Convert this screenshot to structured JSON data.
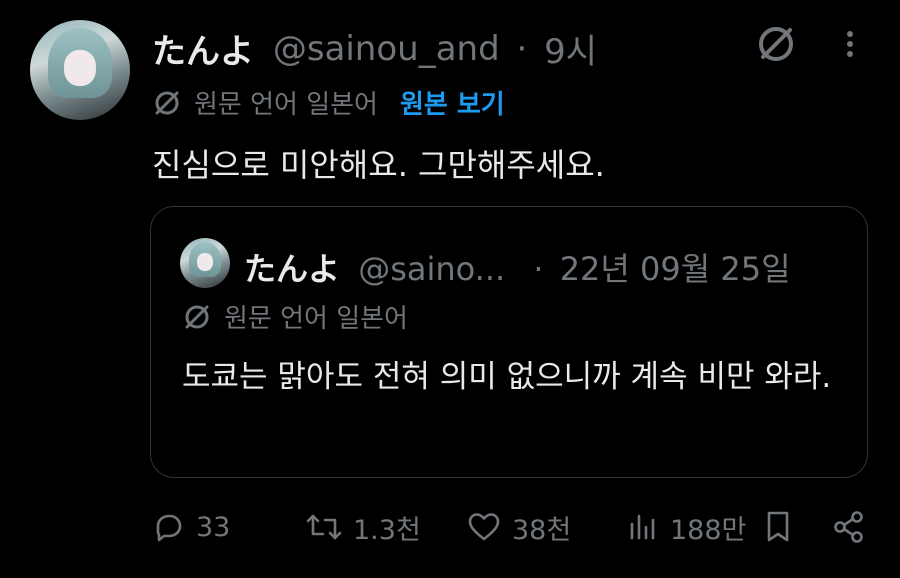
{
  "tweet": {
    "display_name": "たんよ",
    "handle": "@sainou_and",
    "separator": "·",
    "time": "9시",
    "translation_notice": "원문 언어 일본어",
    "show_original": "원본 보기",
    "text": "진심으로 미안해요. 그만해주세요."
  },
  "quote": {
    "display_name": "たんよ",
    "handle": "@saino...",
    "separator": "·",
    "date": "22년 09월 25일",
    "translation_notice": "원문 언어 일본어",
    "text": "도쿄는 맑아도 전혀 의미 없으니까 계속 비만 와라."
  },
  "actions": {
    "replies": "33",
    "reposts": "1.3천",
    "likes": "38천",
    "views": "188만"
  },
  "icons": {
    "grok": "grok-icon",
    "more": "more-icon",
    "translate": "translate-icon",
    "reply": "reply-icon",
    "repost": "repost-icon",
    "like": "heart-icon",
    "views": "views-icon",
    "bookmark": "bookmark-icon",
    "share": "share-icon"
  },
  "colors": {
    "background": "#000000",
    "text": "#e7e9ea",
    "muted": "#71767b",
    "accent": "#1d9bf0",
    "border": "#2f3336"
  }
}
